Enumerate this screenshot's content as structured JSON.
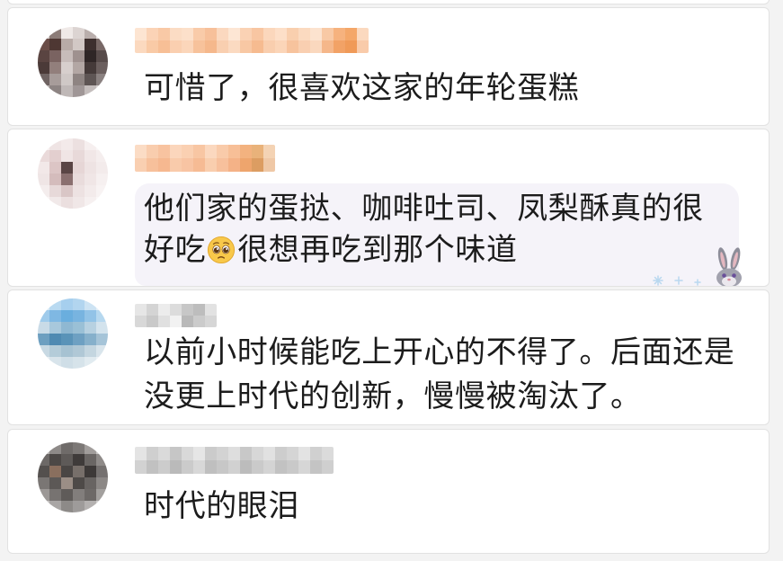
{
  "comments": [
    {
      "lines": [
        "可惜了，很喜欢这家的年轮蛋糕"
      ]
    },
    {
      "lines": [
        "他们家的蛋挞、咖啡吐司、凤梨酥真的很",
        {
          "before": "好吃",
          "emoji": "pleading-face-emoji",
          "after": "很想再吃到那个味道"
        }
      ],
      "sticker": "bunny-sticker"
    },
    {
      "lines": [
        "以前小时候能吃上开心的不得了。后面还是",
        "没更上时代的创新，慢慢被淘汰了。"
      ]
    },
    {
      "lines": [
        "时代的眼泪"
      ]
    }
  ],
  "icons": {
    "avatar": "pixelated-avatar",
    "username": "pixelated-username"
  },
  "colors": {
    "page_bg": "#f3f3f3",
    "card_bg": "#ffffff",
    "card_border": "#e2e2e2",
    "text": "#1c1c1c",
    "bubble_bg": "#f5f3f9"
  }
}
